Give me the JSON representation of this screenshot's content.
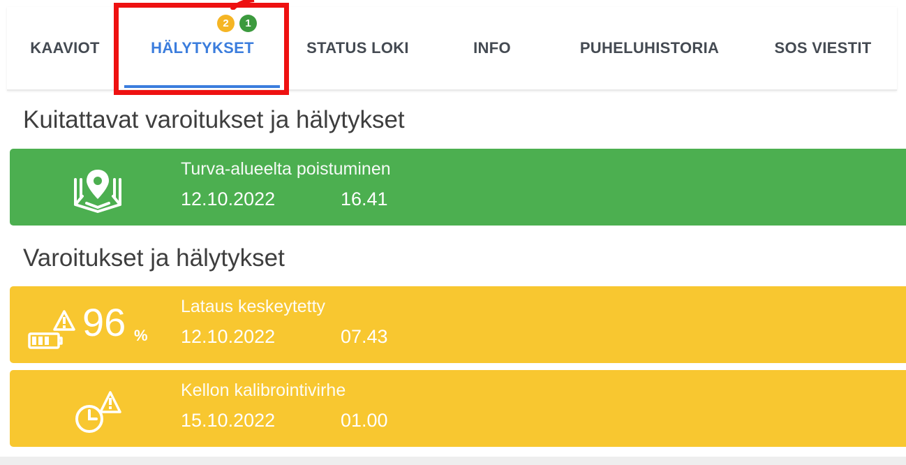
{
  "tabs": [
    {
      "label": "KAAVIOT"
    },
    {
      "label": "HÄLYTYKSET",
      "active": true,
      "badges": [
        {
          "value": "2",
          "color": "#f5b524"
        },
        {
          "value": "1",
          "color": "#3c9a3e"
        }
      ]
    },
    {
      "label": "STATUS LOKI"
    },
    {
      "label": "INFO"
    },
    {
      "label": "PUHELUHISTORIA"
    },
    {
      "label": "SOS VIESTIT"
    }
  ],
  "acknowledgeable": {
    "title": "Kuitattavat varoitukset ja hälytykset",
    "items": [
      {
        "icon": "geofence-icon",
        "title": "Turva-alueelta poistuminen",
        "date": "12.10.2022",
        "time": "16.41",
        "color": "#4caf50"
      }
    ]
  },
  "warnings": {
    "title": "Varoitukset ja hälytykset",
    "items": [
      {
        "icon": "battery-warning-icon",
        "battery_value": "96",
        "battery_unit": "%",
        "title": "Lataus keskeytetty",
        "date": "12.10.2022",
        "time": "07.43",
        "color": "#f8c730"
      },
      {
        "icon": "clock-warning-icon",
        "title": "Kellon kalibrointivirhe",
        "date": "15.10.2022",
        "time": "01.00",
        "color": "#f8c730"
      }
    ]
  },
  "colors": {
    "active_tab": "#3b7ddd",
    "highlight": "#ee1111"
  }
}
